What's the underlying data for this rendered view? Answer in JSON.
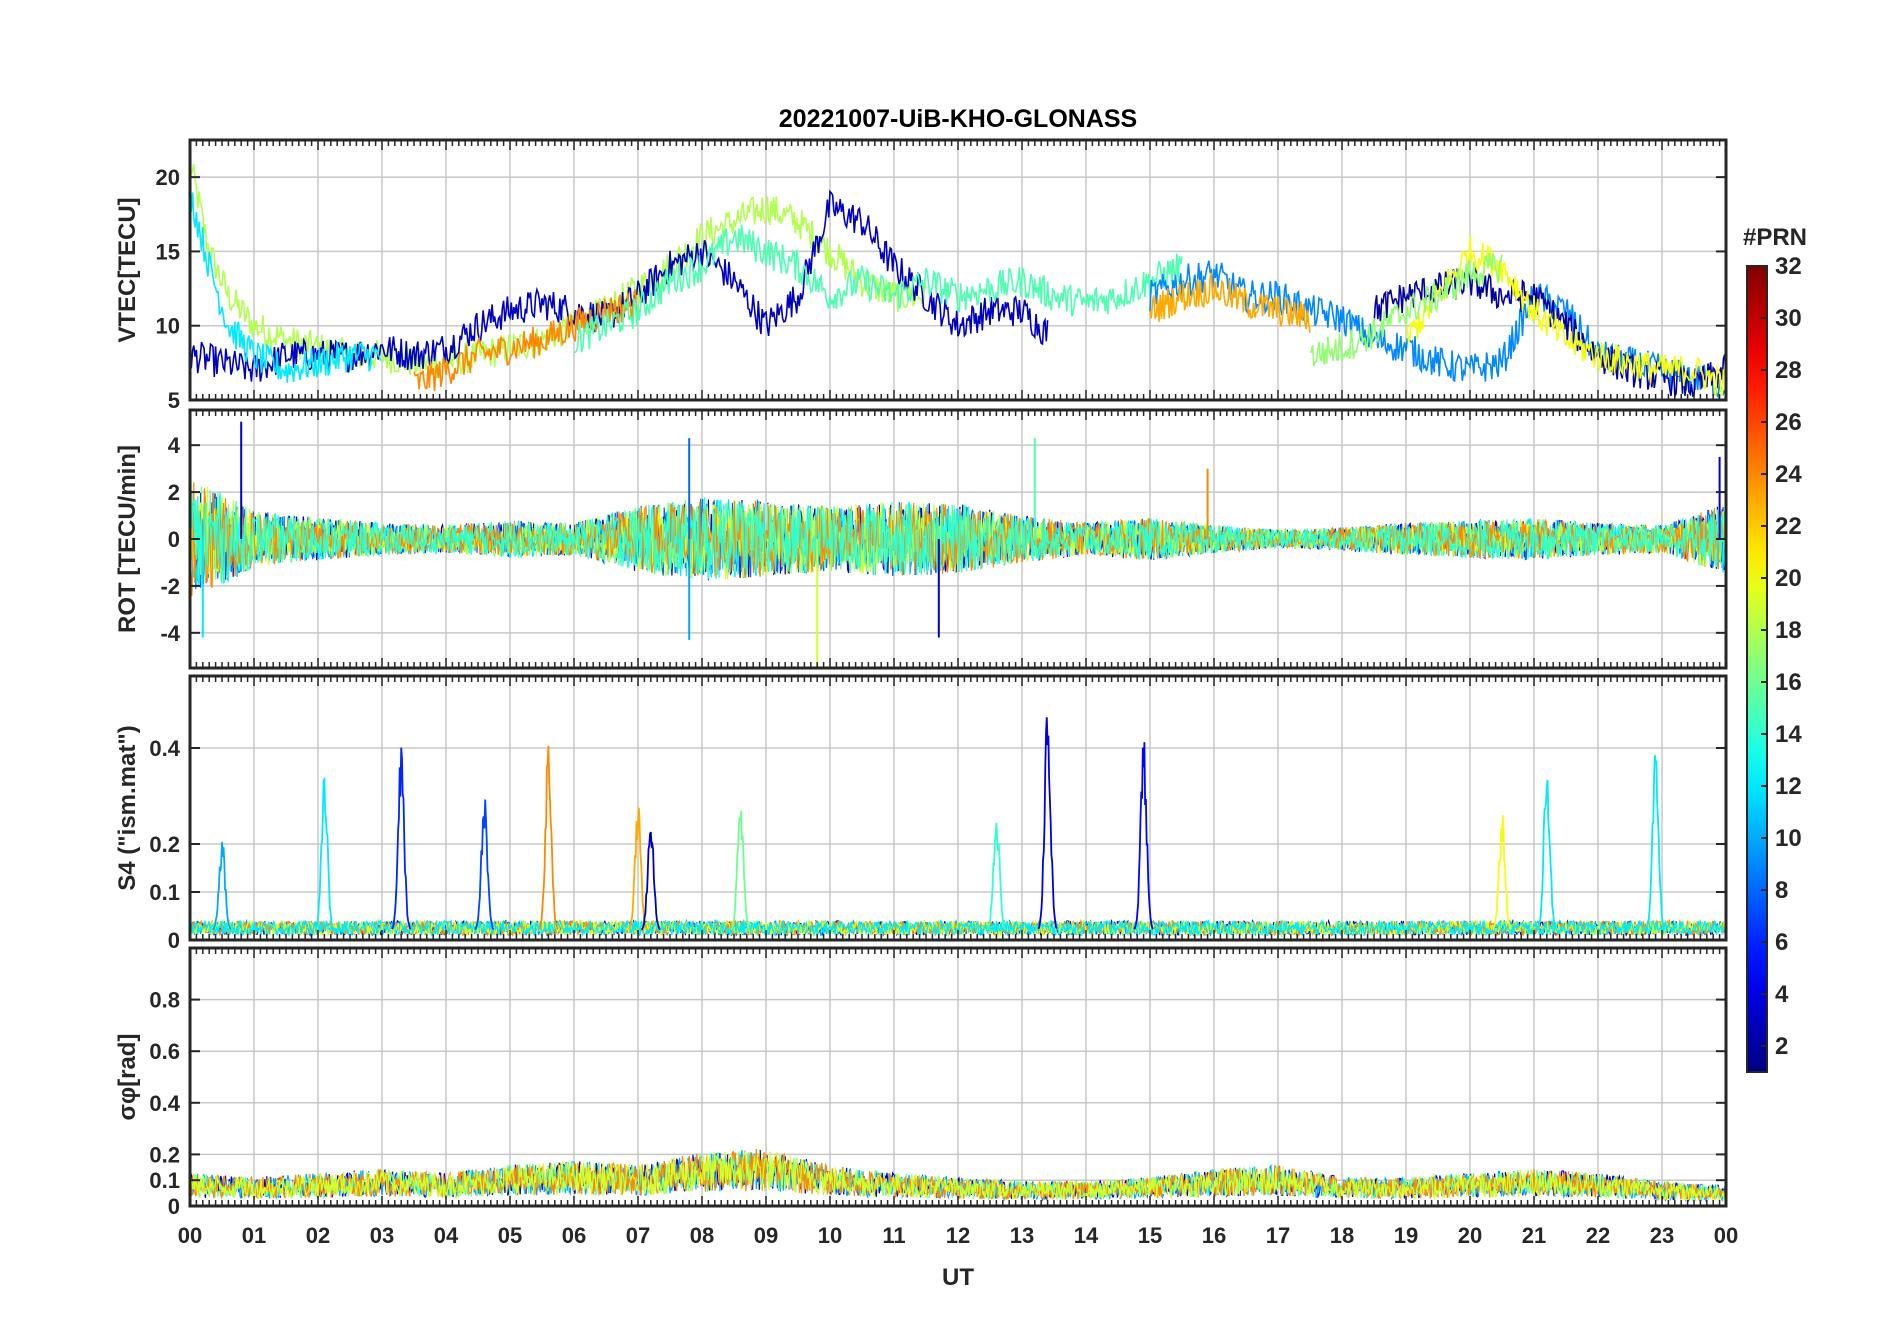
{
  "title": "20221007-UiB-KHO-GLONASS",
  "xlabel": "UT",
  "x_ticks": [
    "00",
    "01",
    "02",
    "03",
    "04",
    "05",
    "06",
    "07",
    "08",
    "09",
    "10",
    "11",
    "12",
    "13",
    "14",
    "15",
    "16",
    "17",
    "18",
    "19",
    "20",
    "21",
    "22",
    "23",
    "00"
  ],
  "colorbar": {
    "label": "#PRN",
    "colormap": "jet",
    "range": [
      1,
      32
    ],
    "ticks": [
      2,
      4,
      6,
      8,
      10,
      12,
      14,
      16,
      18,
      20,
      22,
      24,
      26,
      28,
      30,
      32
    ]
  },
  "chart_data": [
    {
      "type": "line",
      "id": "vtec",
      "ylabel": "VTEC[TECU]",
      "xlim": [
        0,
        24
      ],
      "ylim": [
        5,
        22.5
      ],
      "yticks": [
        5,
        10,
        15,
        20
      ],
      "grid": true,
      "series_note": "multiple PRN traces colored by PRN",
      "series": [
        {
          "prn": 18,
          "x": [
            0,
            0.3,
            0.6,
            1,
            1.5,
            2,
            2.5,
            3,
            3.5,
            4,
            4.5,
            5,
            5.5,
            6,
            6.5,
            7,
            7.5,
            8,
            8.5,
            9,
            9.5,
            10,
            10.5,
            11,
            11.5
          ],
          "y": [
            21,
            15,
            12,
            10,
            9,
            8.5,
            8,
            8,
            7.5,
            7.5,
            8,
            8.5,
            9,
            10,
            11,
            12.5,
            14,
            16,
            17,
            18,
            17,
            15,
            13,
            12,
            12
          ]
        },
        {
          "prn": 3,
          "x": [
            0,
            0.5,
            1,
            1.5,
            2,
            2.5,
            3,
            3.5,
            4,
            4.5,
            5,
            5.5,
            6,
            6.5,
            7,
            7.5,
            8,
            8.5,
            9,
            9.5,
            10,
            10.5,
            11,
            11.5,
            12,
            12.5,
            13,
            13.4
          ],
          "y": [
            8,
            7.5,
            7,
            8,
            8,
            8,
            8.5,
            8,
            8.5,
            10,
            11,
            11.5,
            11,
            10.5,
            12,
            14,
            15,
            13,
            10,
            12,
            18,
            17,
            14,
            12,
            10,
            11,
            11,
            9.5
          ]
        },
        {
          "prn": 12,
          "x": [
            0,
            0.3,
            0.6,
            1,
            1.5,
            2,
            2.5,
            3
          ],
          "y": [
            19,
            14,
            10,
            8,
            7,
            7.5,
            8,
            8
          ]
        },
        {
          "prn": 24,
          "x": [
            3.5,
            4,
            4.5,
            5,
            5.5,
            6,
            6.5,
            7
          ],
          "y": [
            6,
            7,
            8,
            8.5,
            9,
            10,
            11,
            11.5
          ]
        },
        {
          "prn": 15,
          "x": [
            6,
            6.5,
            7,
            7.5,
            8,
            8.5,
            9,
            9.5,
            10,
            10.5,
            11,
            11.5,
            12,
            12.5,
            13,
            13.5,
            14,
            14.5,
            15,
            15.5
          ],
          "y": [
            9,
            10,
            11,
            13,
            14,
            16,
            15,
            14,
            12,
            13,
            12,
            13,
            12,
            12.5,
            13,
            12,
            11.5,
            12,
            13,
            14
          ]
        },
        {
          "prn": 9,
          "x": [
            15,
            15.5,
            16,
            16.5,
            17,
            17.5,
            18,
            18.5,
            19,
            19.5,
            20,
            20.5,
            21,
            21.5,
            22,
            22.5,
            23,
            23.5,
            24
          ],
          "y": [
            12,
            13,
            13.5,
            12,
            12,
            11,
            10.5,
            9,
            8.5,
            7.5,
            7,
            7.5,
            12,
            11,
            8,
            7.5,
            7,
            6.5,
            6
          ]
        },
        {
          "prn": 2,
          "x": [
            18.5,
            19,
            19.5,
            20,
            20.5,
            21,
            21.5,
            22,
            22.5,
            23,
            23.5,
            24
          ],
          "y": [
            11,
            12,
            12.5,
            13,
            12,
            12,
            10,
            8,
            7,
            6.5,
            6,
            7
          ]
        },
        {
          "prn": 20,
          "x": [
            19,
            19.5,
            20,
            20.5,
            21,
            21.5,
            22,
            22.5,
            23,
            23.5,
            24
          ],
          "y": [
            9,
            12,
            15,
            14,
            11,
            9,
            8,
            7.5,
            7,
            7,
            6
          ]
        },
        {
          "prn": 23,
          "x": [
            15,
            15.5,
            16,
            16.5,
            17,
            17.5
          ],
          "y": [
            11,
            12,
            12.5,
            11.5,
            11,
            10.5
          ]
        },
        {
          "prn": 17,
          "x": [
            17.5,
            18,
            18.5,
            19,
            19.5,
            20,
            20.5
          ],
          "y": [
            8,
            8.5,
            9.5,
            11,
            12,
            13.5,
            14
          ]
        }
      ]
    },
    {
      "type": "line",
      "id": "rot",
      "ylabel": "ROT [TECU/min]",
      "xlim": [
        0,
        24
      ],
      "ylim": [
        -5.5,
        5.5
      ],
      "yticks": [
        -4,
        -2,
        0,
        2,
        4
      ],
      "grid": true,
      "series_note": "noisy PRN traces around 0 with amplitude envelope",
      "envelope": {
        "x": [
          0,
          0.5,
          1,
          2,
          3,
          4,
          5,
          6,
          7,
          8,
          9,
          10,
          11,
          12,
          13,
          14,
          15,
          16,
          17,
          18,
          19,
          20,
          21,
          22,
          23,
          24
        ],
        "amp": [
          2.5,
          2,
          1.2,
          0.9,
          0.7,
          0.6,
          0.8,
          0.7,
          1.4,
          1.8,
          1.6,
          1.4,
          1.6,
          1.5,
          1.0,
          0.7,
          0.9,
          0.6,
          0.4,
          0.5,
          0.7,
          0.8,
          0.9,
          0.7,
          0.6,
          1.5
        ]
      },
      "spikes": [
        {
          "x": 0.8,
          "y": 5,
          "prn": 3
        },
        {
          "x": 0.2,
          "y": -4.2,
          "prn": 12
        },
        {
          "x": 7.8,
          "y": 4.3,
          "prn": 8
        },
        {
          "x": 7.8,
          "y": -4.3,
          "prn": 10
        },
        {
          "x": 9.8,
          "y": -5.5,
          "prn": 19
        },
        {
          "x": 11.7,
          "y": -4.2,
          "prn": 3
        },
        {
          "x": 13.2,
          "y": 4.3,
          "prn": 15
        },
        {
          "x": 15.9,
          "y": 3,
          "prn": 24
        },
        {
          "x": 23.9,
          "y": 3.5,
          "prn": 4
        }
      ]
    },
    {
      "type": "line",
      "id": "s4",
      "ylabel": "S4 (\"ism.mat\")",
      "xlim": [
        0,
        24
      ],
      "ylim": [
        0,
        0.55
      ],
      "yticks": [
        0,
        0.1,
        0.2,
        0.4
      ],
      "grid": true,
      "series_note": "low baseline with spikes per PRN",
      "peaks": [
        {
          "x": 0.5,
          "y": 0.2,
          "prn": 10
        },
        {
          "x": 2.1,
          "y": 0.35,
          "prn": 12
        },
        {
          "x": 3.3,
          "y": 0.39,
          "prn": 6
        },
        {
          "x": 4.6,
          "y": 0.3,
          "prn": 7
        },
        {
          "x": 5.6,
          "y": 0.41,
          "prn": 24
        },
        {
          "x": 7.0,
          "y": 0.27,
          "prn": 23
        },
        {
          "x": 7.2,
          "y": 0.25,
          "prn": 3
        },
        {
          "x": 8.6,
          "y": 0.28,
          "prn": 16
        },
        {
          "x": 12.6,
          "y": 0.26,
          "prn": 14
        },
        {
          "x": 13.4,
          "y": 0.49,
          "prn": 4
        },
        {
          "x": 14.9,
          "y": 0.42,
          "prn": 5
        },
        {
          "x": 21.2,
          "y": 0.37,
          "prn": 12
        },
        {
          "x": 22.9,
          "y": 0.38,
          "prn": 12
        },
        {
          "x": 20.5,
          "y": 0.25,
          "prn": 20
        }
      ]
    },
    {
      "type": "line",
      "id": "sigma_phi",
      "ylabel": "σφ[rad]",
      "xlim": [
        0,
        24
      ],
      "ylim": [
        0,
        1.0
      ],
      "yticks": [
        0,
        0.1,
        0.2,
        0.4,
        0.6,
        0.8
      ],
      "grid": true,
      "series_note": "noisy PRN traces near 0.05-0.15",
      "level": {
        "x": [
          0,
          1,
          2,
          3,
          4,
          5,
          6,
          7,
          8,
          9,
          10,
          11,
          12,
          13,
          14,
          15,
          16,
          17,
          18,
          19,
          20,
          21,
          22,
          23,
          24
        ],
        "y": [
          0.08,
          0.07,
          0.08,
          0.09,
          0.08,
          0.1,
          0.11,
          0.1,
          0.13,
          0.14,
          0.1,
          0.08,
          0.07,
          0.06,
          0.06,
          0.07,
          0.09,
          0.1,
          0.07,
          0.07,
          0.08,
          0.09,
          0.08,
          0.06,
          0.05
        ]
      }
    }
  ]
}
